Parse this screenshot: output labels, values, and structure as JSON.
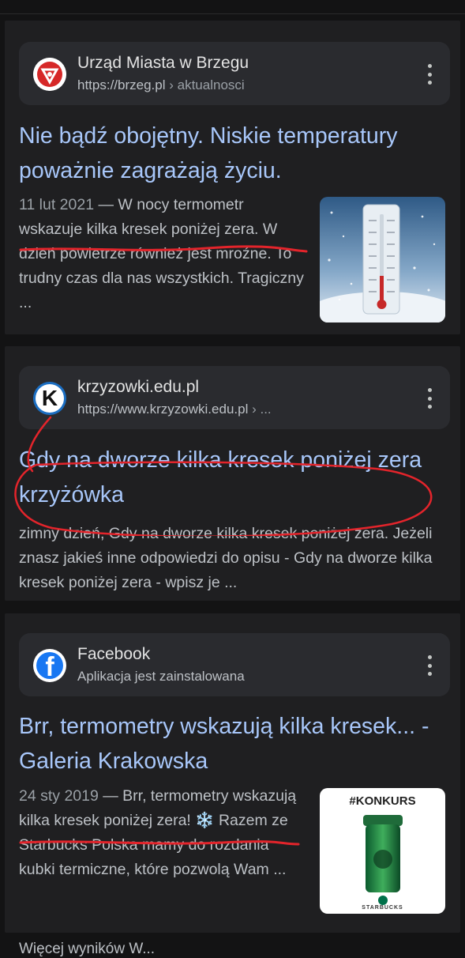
{
  "results": [
    {
      "source_name": "Urząd Miasta w Brzegu",
      "source_url": "https://brzeg.pl",
      "source_crumb": " › aktualnosci",
      "title": "Nie bądź obojętny. Niskie temperatury poważnie zagrażają życiu.",
      "date": "11 lut 2021",
      "snippet": " — W nocy termometr wskazuje kilka kresek poniżej zera. W dzień powietrze również jest mroźne. To trudny czas dla nas wszystkich. Tragiczny ...",
      "favicon": "brzeg-crest-icon",
      "thumbnail": "thermometer-snow-thumbnail"
    },
    {
      "source_name": "krzyzowki.edu.pl",
      "source_url": "https://www.krzyzowki.edu.pl",
      "source_crumb": " › ...",
      "favicon_letter": "K",
      "title": "Gdy na dworze kilka kresek poniżej zera krzyżówka",
      "snippet": "zimny dzień, Gdy na dworze kilka kresek poniżej zera. Jeżeli znasz jakieś inne odpowiedzi do opisu - Gdy na dworze kilka kresek poniżej zera - wpisz je ..."
    },
    {
      "source_name": "Facebook",
      "source_subtitle": "Aplikacja jest zainstalowana",
      "favicon_letter": "f",
      "title": "Brr, termometry wskazują kilka kresek... - Galeria Krakowska",
      "date": "24 sty 2019",
      "snippet": " — Brr, termometry wskazują kilka kresek poniżej zera! ❄️ Razem ze Starbucks Polska mamy do rozdania kubki termiczne, które pozwolą Wam ...",
      "thumbnail": "starbucks-tumbler-thumbnail",
      "thumb_caption": "#KONKURS",
      "thumb_brand": "STARBUCKS"
    }
  ],
  "next_result_partial": "Więcej wyników W...",
  "colors": {
    "background": "#131314",
    "card": "#1f1f21",
    "title_link": "#a8c7fa",
    "annotation": "#e3242b"
  }
}
